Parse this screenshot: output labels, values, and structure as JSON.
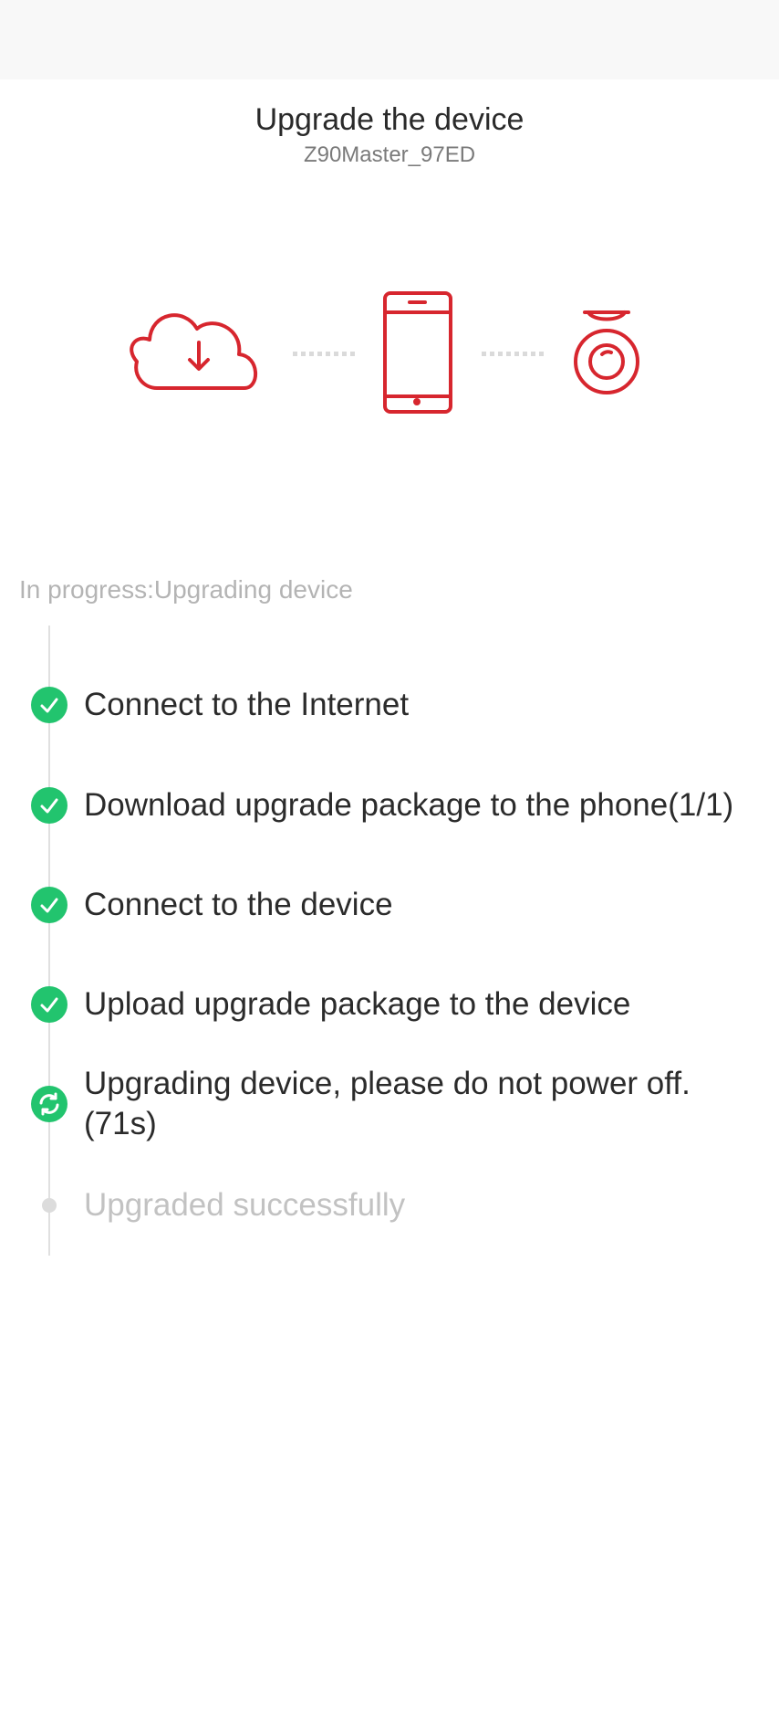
{
  "header": {
    "title": "Upgrade the device",
    "device_name": "Z90Master_97ED"
  },
  "illustration": {
    "icons": [
      "cloud-download-icon",
      "smartphone-icon",
      "dashcam-icon"
    ],
    "accent_color": "#d7262e"
  },
  "progress": {
    "label": "In progress:Upgrading device"
  },
  "steps": [
    {
      "label": "Connect to the Internet",
      "status": "done"
    },
    {
      "label": "Download upgrade package to the phone(1/1)",
      "status": "done"
    },
    {
      "label": "Connect to the device",
      "status": "done"
    },
    {
      "label": "Upload upgrade package to the device",
      "status": "done"
    },
    {
      "label": "Upgrading device, please do not power off.(71s)",
      "status": "in-progress"
    },
    {
      "label": "Upgraded successfully",
      "status": "pending"
    }
  ],
  "colors": {
    "success": "#22c46e",
    "pending": "#dcdcdc",
    "accent": "#d7262e"
  }
}
